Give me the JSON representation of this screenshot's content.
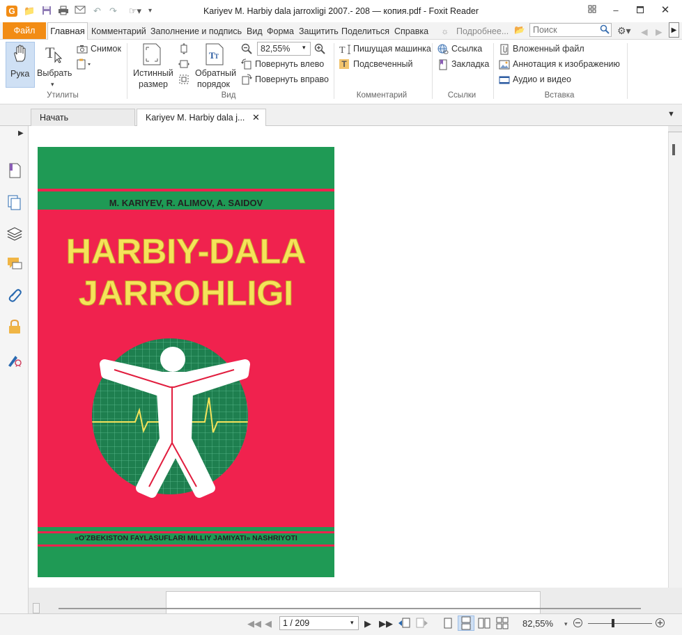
{
  "window": {
    "title": "Kariyev M. Harbiy dala jarroxligi 2007.- 208 — копия.pdf - Foxit Reader"
  },
  "menu": {
    "file": "Файл",
    "home": "Главная",
    "items": [
      "Комментарий",
      "Заполнение и подпись",
      "Вид",
      "Форма",
      "Защитить",
      "Поделиться",
      "Справка"
    ],
    "more": "Подробнее...",
    "search_placeholder": "Поиск"
  },
  "ribbon": {
    "utilities": {
      "hand": "Рука",
      "select": "Выбрать",
      "snapshot": "Снимок",
      "group": "Утилиты"
    },
    "view": {
      "actual_size_1": "Истинный",
      "actual_size_2": "размер",
      "reverse_1": "Обратный",
      "reverse_2": "порядок",
      "zoom": "82,55%",
      "rotate_left": "Повернуть влево",
      "rotate_right": "Повернуть вправо",
      "group": "Вид"
    },
    "comment": {
      "typewriter": "Пишущая машинка",
      "highlight": "Подсвеченный",
      "group": "Комментарий"
    },
    "links": {
      "link": "Ссылка",
      "bookmark": "Закладка",
      "group": "Ссылки"
    },
    "insert": {
      "attachment": "Вложенный файл",
      "image_annotation": "Аннотация к изображению",
      "audio_video": "Аудио и видео",
      "group": "Вставка"
    }
  },
  "tabs": {
    "start": "Начать",
    "document": "Kariyev M. Harbiy dala j..."
  },
  "cover": {
    "authors": "M. KARIYEV, R. ALIMOV, A. SAIDOV",
    "title_line1": "HARBIY-DALA",
    "title_line2": "JARROHLIGI",
    "publisher": "«O'ZBEKISTON FAYLASUFLARI MILLIY JAMIYATI» NASHRIYOTI",
    "colors": {
      "pink": "#f0224e",
      "green": "#1f9a55",
      "yellow": "#f5e35a",
      "circle": "#1e7f4f"
    }
  },
  "status": {
    "page": "1 / 209",
    "zoom": "82,55%"
  },
  "colors": {
    "accent": "#f28c14"
  }
}
